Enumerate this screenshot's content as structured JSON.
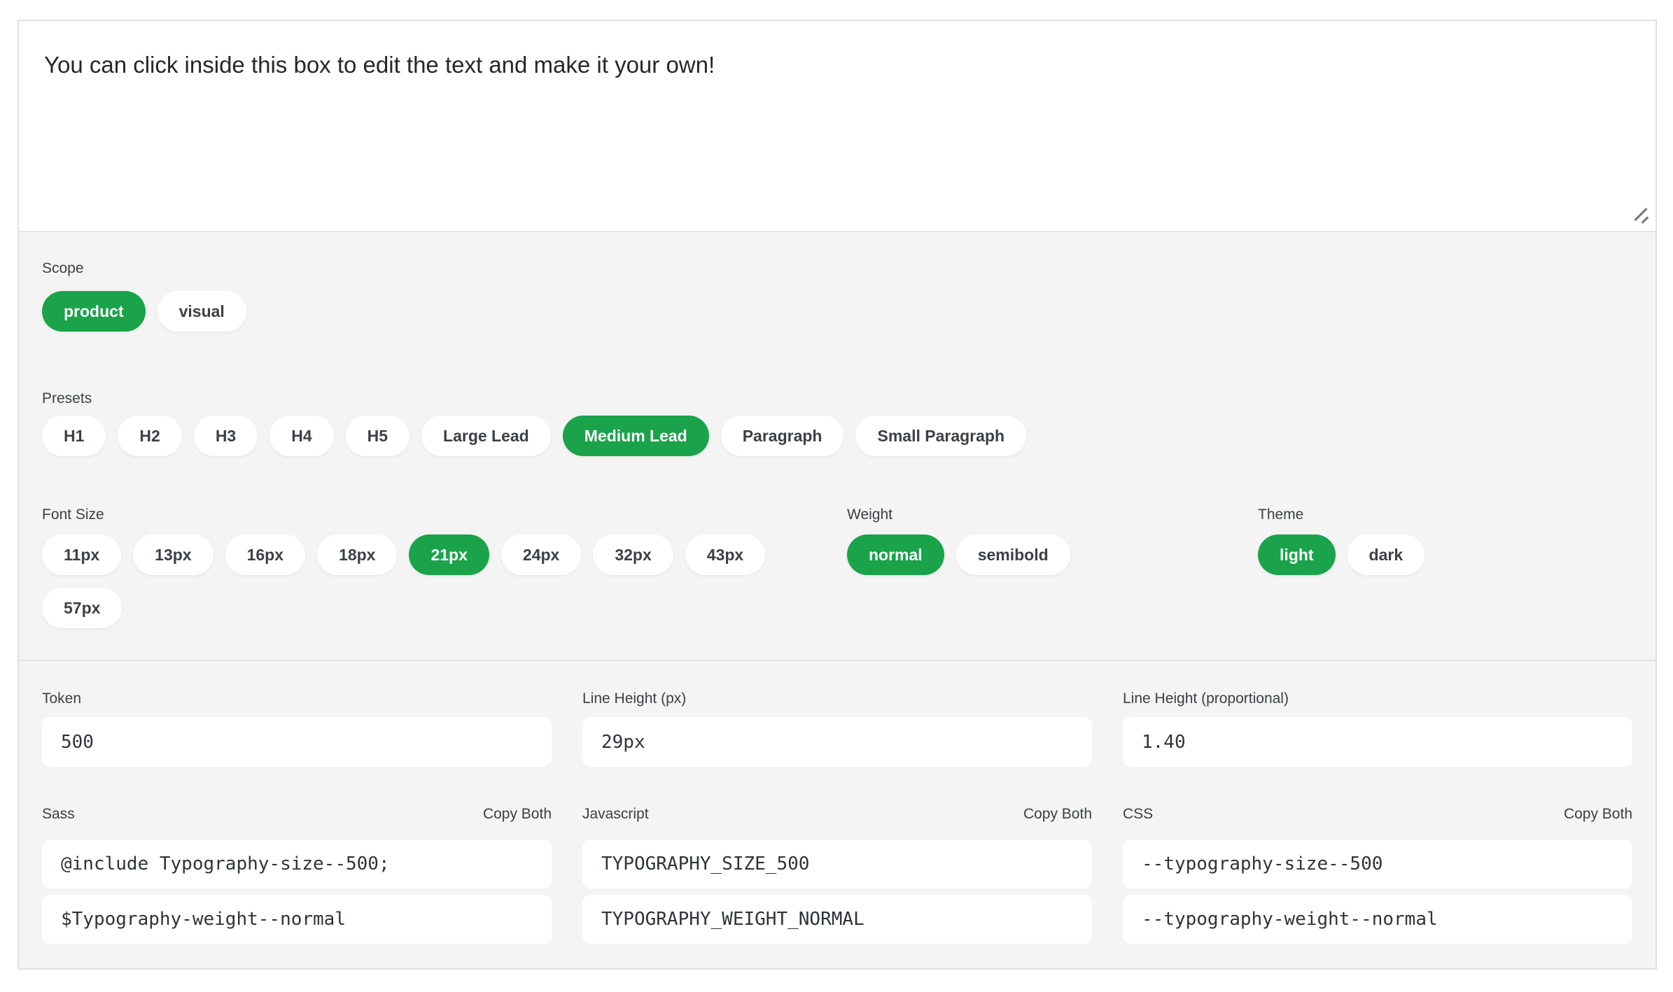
{
  "colors": {
    "accent_green": "#1aa34a",
    "selected_text": "#ffffff",
    "panel_background": "#f3f4f3"
  },
  "preview": {
    "text": "You can click inside this box to edit the text and make it your own!"
  },
  "controls": {
    "scope": {
      "label": "Scope",
      "options": [
        {
          "label": "product",
          "selected": true
        },
        {
          "label": "visual",
          "selected": false
        }
      ]
    },
    "presets": {
      "label": "Presets",
      "options": [
        {
          "label": "H1",
          "selected": false
        },
        {
          "label": "H2",
          "selected": false
        },
        {
          "label": "H3",
          "selected": false
        },
        {
          "label": "H4",
          "selected": false
        },
        {
          "label": "H5",
          "selected": false
        },
        {
          "label": "Large Lead",
          "selected": false
        },
        {
          "label": "Medium Lead",
          "selected": true
        },
        {
          "label": "Paragraph",
          "selected": false
        },
        {
          "label": "Small Paragraph",
          "selected": false
        }
      ]
    },
    "font_size": {
      "label": "Font Size",
      "options": [
        {
          "label": "11px",
          "selected": false
        },
        {
          "label": "13px",
          "selected": false
        },
        {
          "label": "16px",
          "selected": false
        },
        {
          "label": "18px",
          "selected": false
        },
        {
          "label": "21px",
          "selected": true
        },
        {
          "label": "24px",
          "selected": false
        },
        {
          "label": "32px",
          "selected": false
        },
        {
          "label": "43px",
          "selected": false
        },
        {
          "label": "57px",
          "selected": false
        }
      ]
    },
    "weight": {
      "label": "Weight",
      "options": [
        {
          "label": "normal",
          "selected": true
        },
        {
          "label": "semibold",
          "selected": false
        }
      ]
    },
    "theme": {
      "label": "Theme",
      "options": [
        {
          "label": "light",
          "selected": true
        },
        {
          "label": "dark",
          "selected": false
        }
      ]
    }
  },
  "outputs": {
    "token": {
      "label": "Token",
      "value": "500"
    },
    "line_height_px": {
      "label": "Line Height (px)",
      "value": "29px"
    },
    "line_height_proportional": {
      "label": "Line Height (proportional)",
      "value": "1.40"
    },
    "sass": {
      "label": "Sass",
      "copy_label": "Copy Both",
      "lines": [
        "@include Typography-size--500;",
        "$Typography-weight--normal"
      ]
    },
    "javascript": {
      "label": "Javascript",
      "copy_label": "Copy Both",
      "lines": [
        "TYPOGRAPHY_SIZE_500",
        "TYPOGRAPHY_WEIGHT_NORMAL"
      ]
    },
    "css": {
      "label": "CSS",
      "copy_label": "Copy Both",
      "lines": [
        "--typography-size--500",
        "--typography-weight--normal"
      ]
    }
  }
}
